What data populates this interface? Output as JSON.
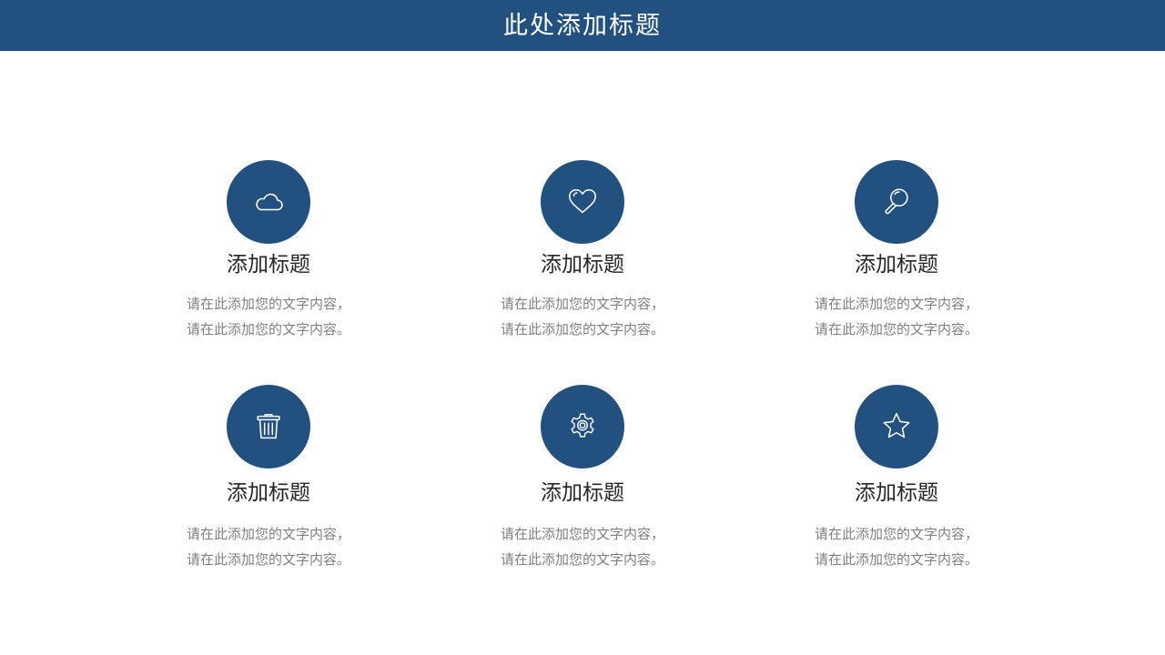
{
  "header": {
    "title": "此处添加标题",
    "background_color": "#22507f"
  },
  "accent_color": "#22507f",
  "cards": [
    {
      "icon": "cloud-icon",
      "title": "添加标题",
      "desc_line1": "请在此添加您的文字内容，",
      "desc_line2": "请在此添加您的文字内容。"
    },
    {
      "icon": "heart-icon",
      "title": "添加标题",
      "desc_line1": "请在此添加您的文字内容，",
      "desc_line2": "请在此添加您的文字内容。"
    },
    {
      "icon": "search-icon",
      "title": "添加标题",
      "desc_line1": "请在此添加您的文字内容，",
      "desc_line2": "请在此添加您的文字内容。"
    },
    {
      "icon": "trash-icon",
      "title": "添加标题",
      "desc_line1": "请在此添加您的文字内容，",
      "desc_line2": "请在此添加您的文字内容。"
    },
    {
      "icon": "gear-icon",
      "title": "添加标题",
      "desc_line1": "请在此添加您的文字内容，",
      "desc_line2": "请在此添加您的文字内容。"
    },
    {
      "icon": "star-icon",
      "title": "添加标题",
      "desc_line1": "请在此添加您的文字内容，",
      "desc_line2": "请在此添加您的文字内容。"
    }
  ]
}
